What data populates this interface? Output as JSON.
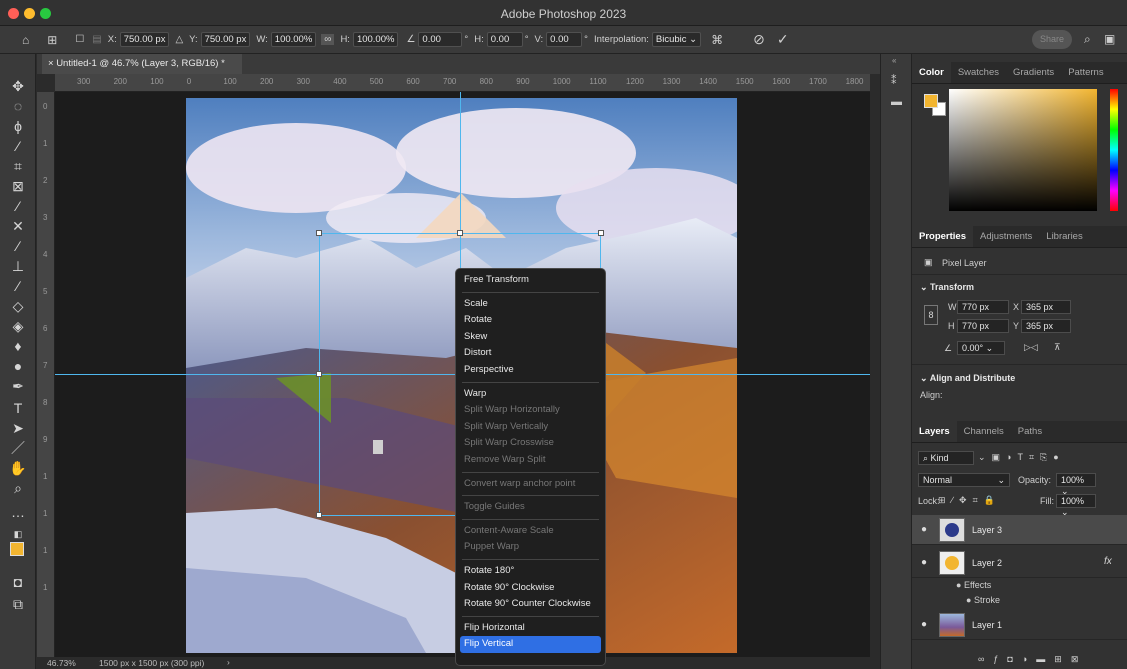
{
  "app": {
    "title": "Adobe Photoshop 2023"
  },
  "options": {
    "x_label": "X:",
    "x_value": "750.00 px",
    "y_label": "Y:",
    "y_value": "750.00 px",
    "w_label": "W:",
    "w_value": "100.00%",
    "h_label": "H:",
    "h_value": "100.00%",
    "angle_value": "0.00",
    "hskew_label": "H:",
    "hskew_value": "0.00",
    "vskew_label": "V:",
    "vskew_value": "0.00",
    "interp_label": "Interpolation:",
    "interp_value": "Bicubic",
    "share_label": "Share"
  },
  "document": {
    "tab_title": "Untitled-1 @ 46.7% (Layer 3, RGB/16) *",
    "zoom": "46.73%",
    "info": "1500 px x 1500 px (300 ppi)",
    "ruler_h": [
      "300",
      "200",
      "100",
      "0",
      "100",
      "200",
      "300",
      "400",
      "500",
      "600",
      "700",
      "800",
      "900",
      "1000",
      "1100",
      "1200",
      "1300",
      "1400",
      "1500",
      "1600",
      "1700",
      "1800"
    ],
    "ruler_v": [
      "0",
      "1",
      "2",
      "3",
      "4",
      "5",
      "6",
      "7",
      "8",
      "9",
      "1",
      "1",
      "1",
      "1"
    ]
  },
  "menu": {
    "items": [
      {
        "label": "Free Transform",
        "state": "normal"
      },
      {
        "sep": true
      },
      {
        "label": "Scale",
        "state": "normal"
      },
      {
        "label": "Rotate",
        "state": "normal"
      },
      {
        "label": "Skew",
        "state": "normal"
      },
      {
        "label": "Distort",
        "state": "normal"
      },
      {
        "label": "Perspective",
        "state": "normal"
      },
      {
        "sep": true
      },
      {
        "label": "Warp",
        "state": "normal"
      },
      {
        "label": "Split Warp Horizontally",
        "state": "disabled"
      },
      {
        "label": "Split Warp Vertically",
        "state": "disabled"
      },
      {
        "label": "Split Warp Crosswise",
        "state": "disabled"
      },
      {
        "label": "Remove Warp Split",
        "state": "disabled"
      },
      {
        "sep": true
      },
      {
        "label": "Convert warp anchor point",
        "state": "disabled"
      },
      {
        "sep": true
      },
      {
        "label": "Toggle Guides",
        "state": "disabled"
      },
      {
        "sep": true
      },
      {
        "label": "Content-Aware Scale",
        "state": "disabled"
      },
      {
        "label": "Puppet Warp",
        "state": "disabled"
      },
      {
        "sep": true
      },
      {
        "label": "Rotate 180°",
        "state": "normal"
      },
      {
        "label": "Rotate 90° Clockwise",
        "state": "normal"
      },
      {
        "label": "Rotate 90° Counter Clockwise",
        "state": "normal"
      },
      {
        "sep": true
      },
      {
        "label": "Flip Horizontal",
        "state": "normal"
      },
      {
        "label": "Flip Vertical",
        "state": "selected"
      }
    ]
  },
  "color_panel": {
    "tabs": [
      "Color",
      "Swatches",
      "Gradients",
      "Patterns"
    ],
    "fg_color": "#f2b530"
  },
  "properties": {
    "tabs": [
      "Properties",
      "Adjustments",
      "Libraries"
    ],
    "kind": "Pixel Layer",
    "transform_title": "Transform",
    "w_label": "W",
    "w": "770 px",
    "x_label": "X",
    "x": "365 px",
    "h_label": "H",
    "h": "770 px",
    "y_label": "Y",
    "y": "365 px",
    "angle": "0.00°",
    "align_title": "Align and Distribute",
    "align_label": "Align:"
  },
  "layers": {
    "tabs": [
      "Layers",
      "Channels",
      "Paths"
    ],
    "filter": "Kind",
    "blend": "Normal",
    "opacity_label": "Opacity:",
    "opacity": "100%",
    "lock_label": "Lock:",
    "fill_label": "Fill:",
    "fill": "100%",
    "items": [
      {
        "name": "Layer 3"
      },
      {
        "name": "Layer 2"
      },
      {
        "name": "Layer 1"
      }
    ],
    "effects_label": "Effects",
    "stroke_label": "Stroke",
    "fx": "fx"
  }
}
